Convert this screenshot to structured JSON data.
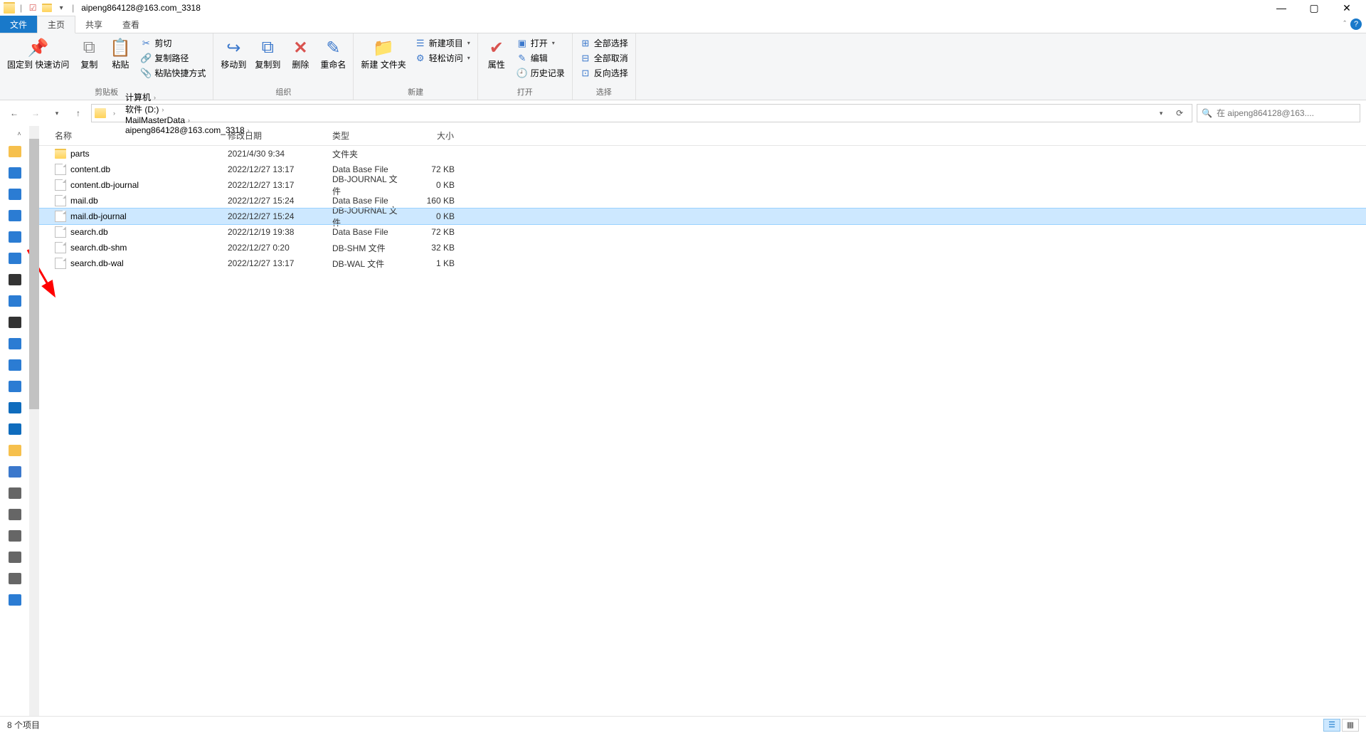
{
  "title": "aipeng864128@163.com_3318",
  "tabs": {
    "file": "文件",
    "home": "主页",
    "share": "共享",
    "view": "查看"
  },
  "ribbon": {
    "clipboard": {
      "label": "剪贴板",
      "pin": "固定到\n快速访问",
      "copy": "复制",
      "paste": "粘贴",
      "cut": "剪切",
      "copy_path": "复制路径",
      "paste_shortcut": "粘贴快捷方式"
    },
    "organize": {
      "label": "组织",
      "move_to": "移动到",
      "copy_to": "复制到",
      "delete": "删除",
      "rename": "重命名"
    },
    "new": {
      "label": "新建",
      "new_folder": "新建\n文件夹",
      "new_item": "新建项目",
      "easy_access": "轻松访问"
    },
    "open": {
      "label": "打开",
      "properties": "属性",
      "open": "打开",
      "edit": "编辑",
      "history": "历史记录"
    },
    "select": {
      "label": "选择",
      "all": "全部选择",
      "none": "全部取消",
      "invert": "反向选择"
    }
  },
  "breadcrumbs": [
    "计算机",
    "软件 (D:)",
    "MailMasterData",
    "aipeng864128@163.com_3318"
  ],
  "search_placeholder": "在 aipeng864128@163....",
  "columns": {
    "name": "名称",
    "date": "修改日期",
    "type": "类型",
    "size": "大小"
  },
  "rows": [
    {
      "icon": "folder",
      "name": "parts",
      "date": "2021/4/30 9:34",
      "type": "文件夹",
      "size": ""
    },
    {
      "icon": "file",
      "name": "content.db",
      "date": "2022/12/27 13:17",
      "type": "Data Base File",
      "size": "72 KB"
    },
    {
      "icon": "file",
      "name": "content.db-journal",
      "date": "2022/12/27 13:17",
      "type": "DB-JOURNAL 文件",
      "size": "0 KB"
    },
    {
      "icon": "file",
      "name": "mail.db",
      "date": "2022/12/27 15:24",
      "type": "Data Base File",
      "size": "160 KB"
    },
    {
      "icon": "file",
      "name": "mail.db-journal",
      "date": "2022/12/27 15:24",
      "type": "DB-JOURNAL 文件",
      "size": "0 KB",
      "selected": true
    },
    {
      "icon": "file",
      "name": "search.db",
      "date": "2022/12/19 19:38",
      "type": "Data Base File",
      "size": "72 KB"
    },
    {
      "icon": "file",
      "name": "search.db-shm",
      "date": "2022/12/27 0:20",
      "type": "DB-SHM 文件",
      "size": "32 KB"
    },
    {
      "icon": "file",
      "name": "search.db-wal",
      "date": "2022/12/27 13:17",
      "type": "DB-WAL 文件",
      "size": "1 KB"
    }
  ],
  "status": "8 个项目",
  "nav_icons": [
    {
      "c": "#f6c04d"
    },
    {
      "c": "#2b7cd3"
    },
    {
      "c": "#2b7cd3"
    },
    {
      "c": "#2b7cd3"
    },
    {
      "c": "#2b7cd3"
    },
    {
      "c": "#2b7cd3"
    },
    {
      "c": "#333"
    },
    {
      "c": "#2b7cd3"
    },
    {
      "c": "#333"
    },
    {
      "c": "#2b7cd3"
    },
    {
      "c": "#2b7cd3"
    },
    {
      "c": "#2b7cd3"
    },
    {
      "c": "#0f6cbd"
    },
    {
      "c": "#0f6cbd"
    },
    {
      "c": "#f6c04d"
    },
    {
      "c": "#3b78cc"
    },
    {
      "c": "#666"
    },
    {
      "c": "#666"
    },
    {
      "c": "#666"
    },
    {
      "c": "#666"
    },
    {
      "c": "#666"
    },
    {
      "c": "#2b7cd3"
    }
  ]
}
